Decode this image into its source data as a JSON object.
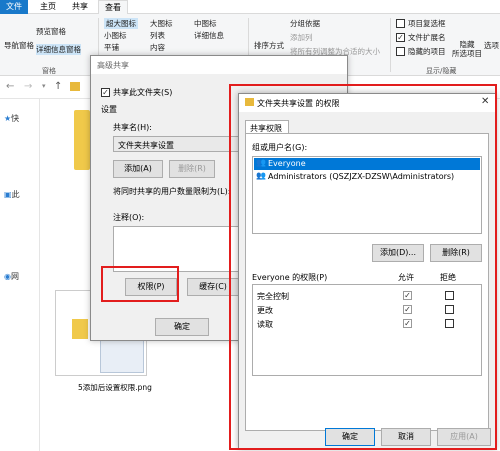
{
  "explorer": {
    "tabs": [
      "文件",
      "主页",
      "共享",
      "查看"
    ],
    "ribbon": {
      "nav_pane": "导航窗格",
      "preview_pane": "预览窗格",
      "details_pane": "详细信息窗格",
      "panes_group": "窗格",
      "xl_icons": "超大图标",
      "large_icons": "大图标",
      "medium_icons": "中图标",
      "small_icons": "小图标",
      "list": "列表",
      "details": "详细信息",
      "tiles": "平铺",
      "content": "内容",
      "sort_by": "排序方式",
      "group_by": "分组依据",
      "add_columns": "添加列",
      "fit_columns": "将所有列调整为合适的大小",
      "item_checkboxes": "项目复选框",
      "file_ext": "文件扩展名",
      "hidden_items": "隐藏的项目",
      "hide_selected": "隐藏\n所选项目",
      "show_hide_group": "显示/隐藏",
      "options": "选项"
    },
    "nav_items": [
      "快",
      "此",
      "网"
    ],
    "thumb_caption": "5添加后设置权限.png"
  },
  "advanced_share": {
    "title": "高级共享",
    "share_checkbox": "共享此文件夹(S)",
    "settings_label": "设置",
    "share_name_label": "共享名(H):",
    "share_name_value": "文件夹共享设置",
    "add_button": "添加(A)",
    "delete_button": "删除(R)",
    "limit_label": "将同时共享的用户数量限制为(L):",
    "comment_label": "注释(O):",
    "permissions_button": "权限(P)",
    "cache_button": "缓存(C)",
    "ok_button": "确定"
  },
  "permissions_dialog": {
    "title": "文件夹共享设置 的权限",
    "tab": "共享权限",
    "group_label": "组或用户名(G):",
    "users": [
      "Everyone",
      "Administrators (QSZJZX-DZSW\\Administrators)"
    ],
    "add_button": "添加(D)...",
    "remove_button": "删除(R)",
    "perm_header": "Everyone 的权限(P)",
    "allow_header": "允许",
    "deny_header": "拒绝",
    "permissions": [
      {
        "name": "完全控制",
        "allow": true,
        "deny": false
      },
      {
        "name": "更改",
        "allow": true,
        "deny": false
      },
      {
        "name": "读取",
        "allow": true,
        "deny": false
      }
    ],
    "ok_button": "确定",
    "cancel_button": "取消",
    "apply_button": "应用(A)"
  },
  "colors": {
    "accent": "#1979ca",
    "highlight": "#e21d1d",
    "selection": "#0078d7"
  }
}
